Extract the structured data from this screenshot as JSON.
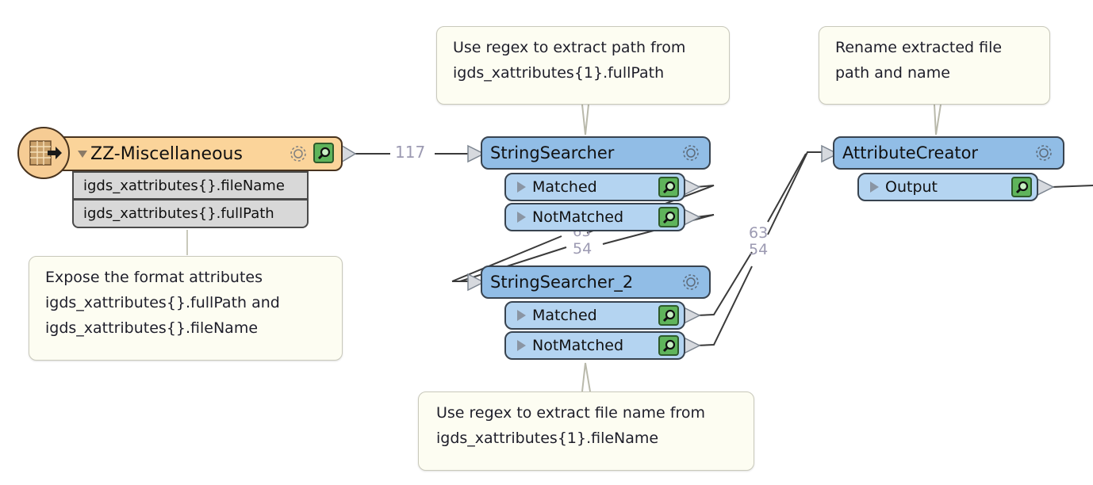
{
  "annotations": {
    "reader_note": "Expose the format attributes\nigds_xattributes{}.fullPath and\nigds_xattributes{}.fileName",
    "searcher1_note": "Use regex to extract path from\nigds_xattributes{1}.fullPath",
    "searcher2_note": "Use regex to extract file name from\nigds_xattributes{1}.fileName",
    "creator_note": "Rename extracted file\npath and name"
  },
  "reader": {
    "name": "ZZ-Miscellaneous",
    "icon": "table-reader-icon",
    "attributes": [
      "igds_xattributes{}.fileName",
      "igds_xattributes{}.fullPath"
    ],
    "color": "#fbd49a"
  },
  "transformers": {
    "string_searcher": {
      "name": "StringSearcher",
      "ports": [
        "Matched",
        "NotMatched"
      ],
      "color": "#91bde6"
    },
    "string_searcher_2": {
      "name": "StringSearcher_2",
      "ports": [
        "Matched",
        "NotMatched"
      ],
      "color": "#91bde6"
    },
    "attribute_creator": {
      "name": "AttributeCreator",
      "ports": [
        "Output"
      ],
      "color": "#91bde6"
    }
  },
  "link_counts": {
    "reader_to_searcher": "117",
    "searcher_to_searcher2_a": "63",
    "searcher_to_searcher2_b": "54",
    "searcher2_to_creator_a": "63",
    "searcher2_to_creator_b": "54"
  }
}
